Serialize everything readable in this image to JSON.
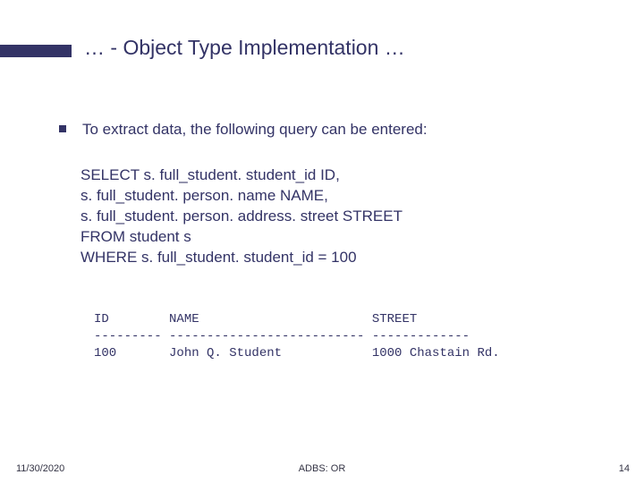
{
  "title": "… - Object Type Implementation …",
  "bullet": "To extract data, the following query can be entered:",
  "query": {
    "l1": "SELECT s. full_student. student_id ID,",
    "l2": "s. full_student. person. name NAME,",
    "l3": "s. full_student. person. address. street STREET",
    "l4": "FROM student s",
    "l5": "WHERE s. full_student. student_id = 100"
  },
  "result": {
    "header": "ID        NAME                       STREET",
    "divider": "--------- -------------------------- -------------",
    "row1": "100       John Q. Student            1000 Chastain Rd."
  },
  "footer": {
    "date": "11/30/2020",
    "center": "ADBS: OR",
    "page": "14"
  }
}
